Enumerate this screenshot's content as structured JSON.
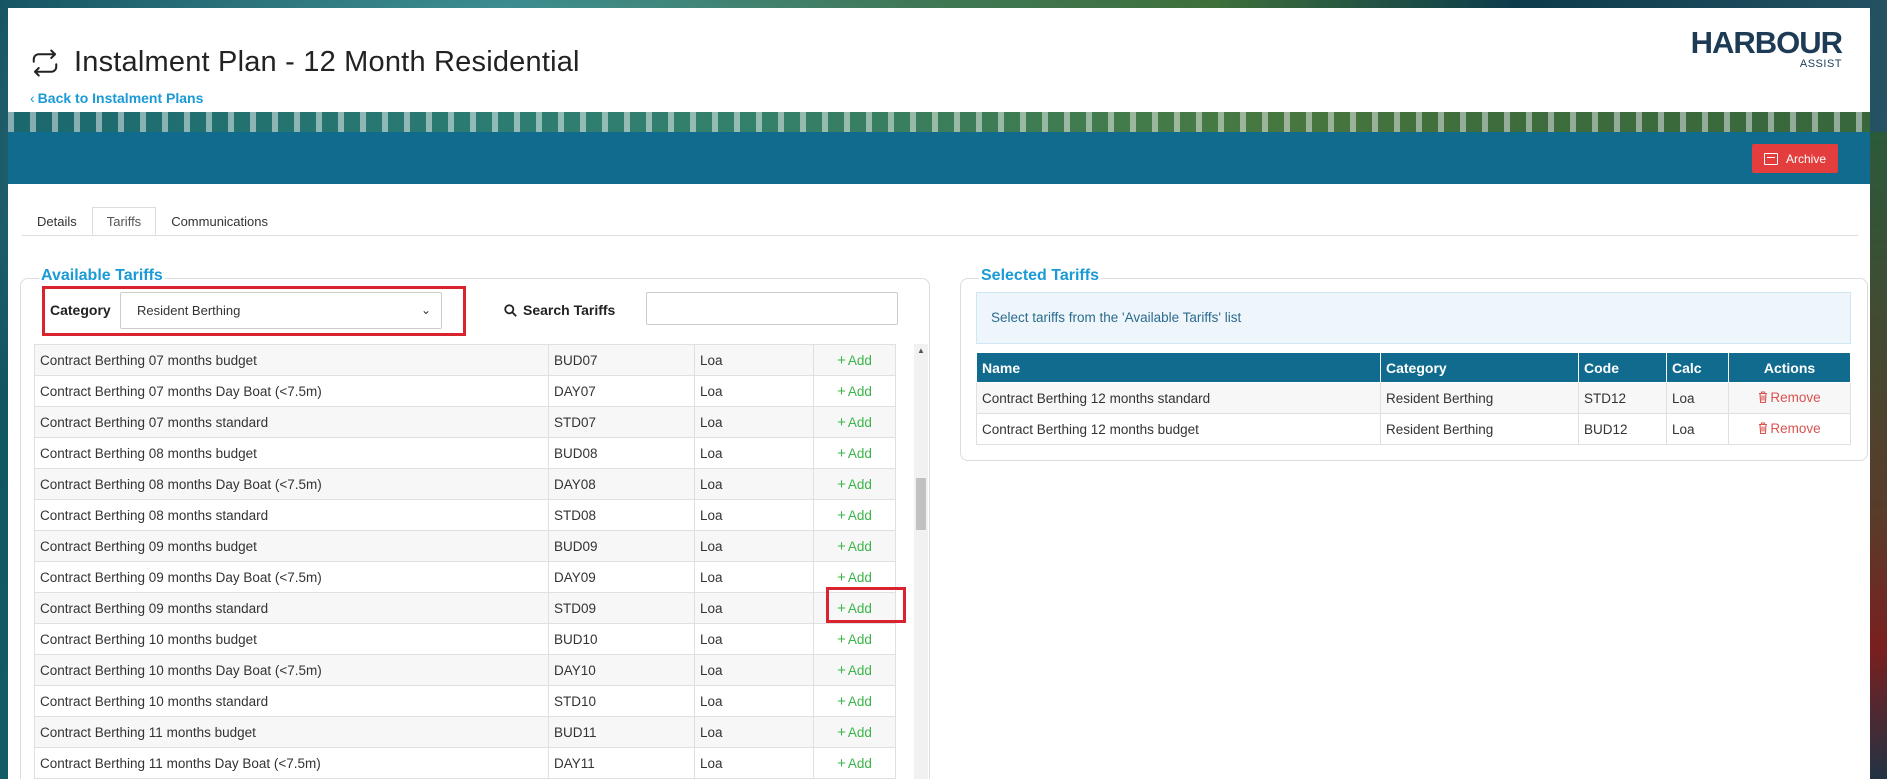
{
  "header": {
    "title": "Instalment Plan - 12 Month Residential",
    "back_link": "Back to Instalment Plans",
    "brand_name": "HARBOUR",
    "brand_sub": "ASSIST"
  },
  "action_bar": {
    "archive_label": "Archive"
  },
  "tabs": [
    {
      "label": "Details",
      "active": false
    },
    {
      "label": "Tariffs",
      "active": true
    },
    {
      "label": "Communications",
      "active": false
    }
  ],
  "available": {
    "title": "Available Tariffs",
    "category_label": "Category",
    "category_value": "Resident Berthing",
    "search_label": "Search Tariffs",
    "search_value": "",
    "add_label": "Add",
    "rows": [
      {
        "name": "Contract Berthing 07 months budget",
        "code": "BUD07",
        "calc": "Loa"
      },
      {
        "name": "Contract Berthing 07 months Day Boat (<7.5m)",
        "code": "DAY07",
        "calc": "Loa"
      },
      {
        "name": "Contract Berthing 07 months standard",
        "code": "STD07",
        "calc": "Loa"
      },
      {
        "name": "Contract Berthing 08 months budget",
        "code": "BUD08",
        "calc": "Loa"
      },
      {
        "name": "Contract Berthing 08 months Day Boat (<7.5m)",
        "code": "DAY08",
        "calc": "Loa"
      },
      {
        "name": "Contract Berthing 08 months standard",
        "code": "STD08",
        "calc": "Loa"
      },
      {
        "name": "Contract Berthing 09 months budget",
        "code": "BUD09",
        "calc": "Loa"
      },
      {
        "name": "Contract Berthing 09 months Day Boat (<7.5m)",
        "code": "DAY09",
        "calc": "Loa"
      },
      {
        "name": "Contract Berthing 09 months standard",
        "code": "STD09",
        "calc": "Loa"
      },
      {
        "name": "Contract Berthing 10 months budget",
        "code": "BUD10",
        "calc": "Loa"
      },
      {
        "name": "Contract Berthing 10 months Day Boat (<7.5m)",
        "code": "DAY10",
        "calc": "Loa"
      },
      {
        "name": "Contract Berthing 10 months standard",
        "code": "STD10",
        "calc": "Loa"
      },
      {
        "name": "Contract Berthing 11 months budget",
        "code": "BUD11",
        "calc": "Loa"
      },
      {
        "name": "Contract Berthing 11 months Day Boat (<7.5m)",
        "code": "DAY11",
        "calc": "Loa"
      }
    ]
  },
  "selected": {
    "title": "Selected Tariffs",
    "info": "Select tariffs from the 'Available Tariffs' list",
    "columns": [
      "Name",
      "Category",
      "Code",
      "Calc",
      "Actions"
    ],
    "remove_label": "Remove",
    "rows": [
      {
        "name": "Contract Berthing 12 months standard",
        "category": "Resident Berthing",
        "code": "STD12",
        "calc": "Loa"
      },
      {
        "name": "Contract Berthing 12 months budget",
        "category": "Resident Berthing",
        "code": "BUD12",
        "calc": "Loa"
      }
    ]
  },
  "colors": {
    "accent": "#1a9ad6",
    "bar": "#106b8f",
    "danger": "#e43d3d",
    "add": "#3bb54a",
    "highlight": "#d9232e"
  }
}
